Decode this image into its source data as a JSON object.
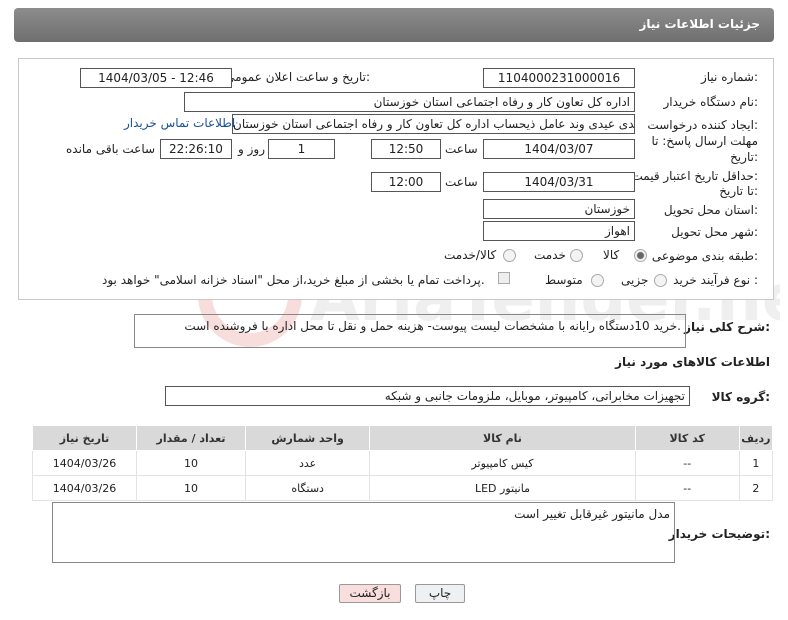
{
  "header": {
    "title": "جزئیات اطلاعات نیاز"
  },
  "form": {
    "need_number_label": "شماره نیاز:",
    "need_number": "1104000231000016",
    "announce_label": "تاریخ و ساعت اعلان عمومی:",
    "announce_value": "1404/03/05 - 12:46",
    "buyer_org_label": "نام دستگاه خریدار:",
    "buyer_org": "اداره کل تعاون  کار و رفاه اجتماعی استان خوزستان",
    "creator_label": "ایجاد کننده درخواست:",
    "creator": "علی اسدی عیدی وند عامل ذیحساب اداره کل تعاون  کار و رفاه اجتماعی استان خوزستان",
    "contact_link": "اطلاعات تماس خریدار",
    "deadline_label_1": "مهلت ارسال پاسخ: تا",
    "deadline_label_2": "تاریخ:",
    "deadline_date": "1404/03/07",
    "time_label": "ساعت",
    "deadline_time": "12:50",
    "days_value": "1",
    "days_label": "روز و",
    "remaining_time": "22:26:10",
    "remaining_label": "ساعت باقی مانده",
    "validity_label_1": "حداقل تاریخ اعتبار قیمت:",
    "validity_label_2": "تا تاریخ:",
    "validity_date": "1404/03/31",
    "validity_time": "12:00",
    "province_label": "استان محل تحویل:",
    "province": "خوزستان",
    "city_label": "شهر محل تحویل:",
    "city": "اهواز",
    "category_label": "طبقه بندی موضوعی:",
    "category_options": [
      "کالا",
      "خدمت",
      "کالا/خدمت"
    ],
    "process_label": "نوع فرآیند خرید :",
    "process_options": [
      "جزیی",
      "متوسط"
    ],
    "payment_note": "پرداخت تمام یا بخشی از مبلغ خرید،از محل \"اسناد خزانه اسلامی\" خواهد بود."
  },
  "description": {
    "label": "شرح کلی نیاز:",
    "text": "خرید  10دستگاه رایانه با مشخصات لیست پیوست- هزینه حمل و نقل تا محل اداره با فروشنده است."
  },
  "goods": {
    "section_title": "اطلاعات کالاهای مورد نیاز",
    "group_label": "گروه کالا:",
    "group_value": "تجهیزات مخابراتی، کامپیوتر، موبایل، ملزومات جانبی و شبکه",
    "columns": [
      "ردیف",
      "کد کالا",
      "نام کالا",
      "واحد شمارش",
      "تعداد / مقدار",
      "تاریخ نیاز"
    ],
    "rows": [
      {
        "idx": "1",
        "code": "--",
        "name": "کیس کامپیوتر",
        "unit": "عدد",
        "qty": "10",
        "date": "1404/03/26"
      },
      {
        "idx": "2",
        "code": "--",
        "name": "مانیتور LED",
        "unit": "دستگاه",
        "qty": "10",
        "date": "1404/03/26"
      }
    ]
  },
  "buyer_notes": {
    "label": "توضیحات خریدار:",
    "text": "مدل مانیتور غیرقابل تغییر است"
  },
  "buttons": {
    "print": "چاپ",
    "back": "بازگشت"
  },
  "watermark": {
    "text": "AriaTender.net"
  }
}
